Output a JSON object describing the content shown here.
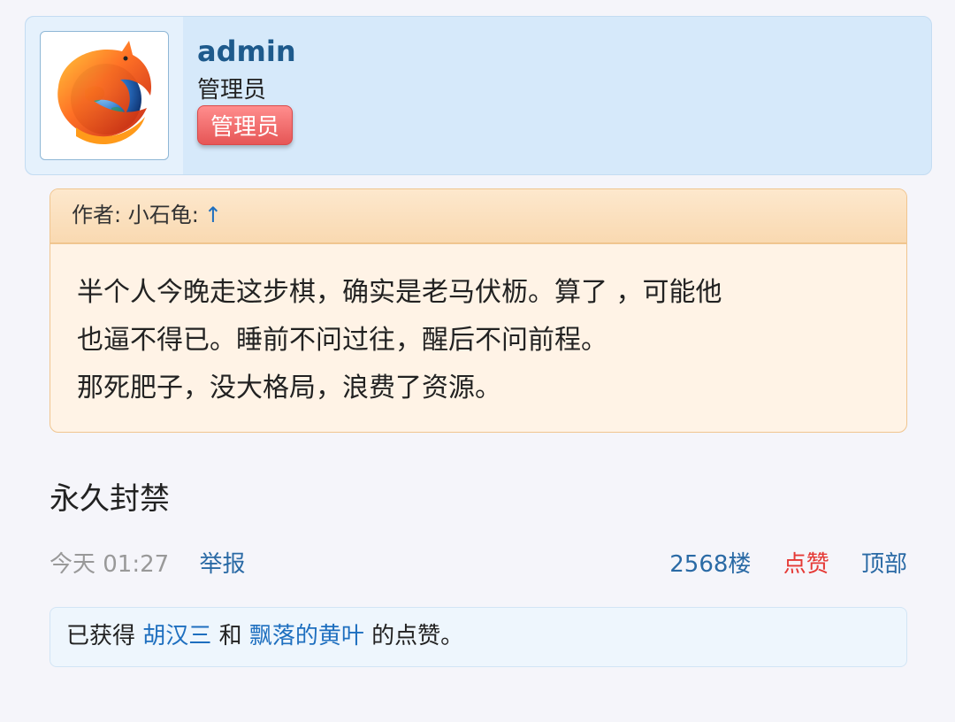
{
  "user": {
    "name": "admin",
    "title": "管理员",
    "badge": "管理员",
    "avatar_icon": "firefox-logo-icon"
  },
  "quote": {
    "author_label": "作者: 小石龟:",
    "jump_arrow": "↑",
    "lines": [
      "半个人今晚走这步棋，确实是老马伏枥。算了 ，可能他",
      "也逼不得已。睡前不问过往，醒后不问前程。",
      "那死肥子，没大格局，浪费了资源。"
    ]
  },
  "post": {
    "content": "永久封禁",
    "time": "今天 01:27",
    "report": "举报",
    "floor": "2568楼",
    "like": "点赞",
    "top": "顶部"
  },
  "likes": {
    "prefix": "已获得",
    "user1": "胡汉三",
    "joiner": "和",
    "user2": "飘落的黄叶",
    "suffix": "的点赞。"
  },
  "colors": {
    "link": "#2a6aa5",
    "like": "#e53935",
    "badge": "#e65656",
    "quote_bg": "#fff3e6",
    "card_bg": "#d6e9fa"
  }
}
